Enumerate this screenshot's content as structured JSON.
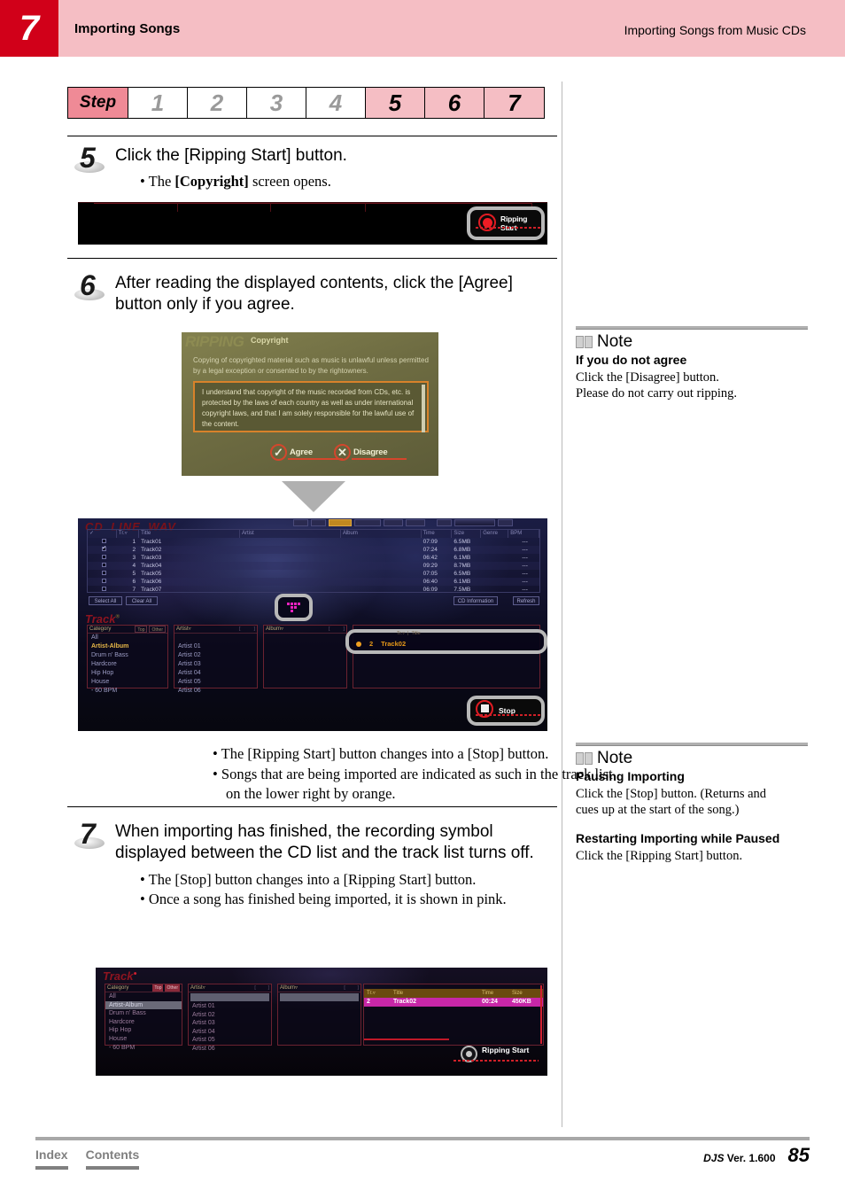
{
  "header": {
    "chapter_number": "7",
    "title": "Importing Songs",
    "subtitle": "Importing Songs from Music CDs"
  },
  "step_indicator": {
    "label": "Step",
    "steps": [
      {
        "num": "1",
        "active": false
      },
      {
        "num": "2",
        "active": false
      },
      {
        "num": "3",
        "active": false
      },
      {
        "num": "4",
        "active": false
      },
      {
        "num": "5",
        "active": true
      },
      {
        "num": "6",
        "active": true
      },
      {
        "num": "7",
        "active": true
      }
    ]
  },
  "steps": {
    "step5": {
      "number": "5",
      "text": "Click the [Ripping Start] button.",
      "bullets_pre": "The ",
      "bullets_bold": "[Copyright]",
      "bullets_post": " screen opens."
    },
    "step6": {
      "number": "6",
      "text": "After reading the displayed contents, click the [Agree] button only if you agree.",
      "bullets": [
        "The [Ripping Start] button changes into a [Stop] button.",
        "Songs that are being imported are indicated as such in the track list on the lower right by orange."
      ]
    },
    "step7": {
      "number": "7",
      "text": "When importing has finished, the recording symbol displayed between the CD list and the track list turns off.",
      "bullets": [
        "The [Stop] button changes into a [Ripping Start]  button.",
        "Once a song has finished being imported, it is shown in pink."
      ]
    }
  },
  "screenshot_ripping_bar": {
    "button_label": "Ripping Start"
  },
  "screenshot_copyright": {
    "watermark": "RIPPING",
    "dialog_title": "Copyright",
    "intro_text": "Copying of copyrighted material such as music is unlawful unless permitted by a legal exception or consented to by the rightowners.",
    "agreement_text": "I understand that copyright of the music recorded from CDs, etc. is protected by the laws of each country as well as under international copyright laws, and that I am solely responsible for the lawful use of the content.",
    "agree_label": "Agree",
    "agree_icon": "check-icon",
    "disagree_label": "Disagree",
    "disagree_icon": "cross-icon"
  },
  "screenshot_main": {
    "tabs": [
      "CD",
      "LINE",
      "WAV"
    ],
    "cd_list": {
      "columns": [
        "✓",
        "Tr.▿",
        "Title",
        "Artist",
        "Album",
        "Time",
        "Size",
        "Genre",
        "BPM"
      ],
      "rows": [
        {
          "checked": false,
          "tr": "1",
          "title": "Track01",
          "artist": "",
          "album": "",
          "time": "07:09",
          "size": "6.5MB",
          "genre": "",
          "bpm": "---"
        },
        {
          "checked": true,
          "tr": "2",
          "title": "Track02",
          "artist": "",
          "album": "",
          "time": "07:24",
          "size": "6.8MB",
          "genre": "",
          "bpm": "---"
        },
        {
          "checked": false,
          "tr": "3",
          "title": "Track03",
          "artist": "",
          "album": "",
          "time": "06:42",
          "size": "6.1MB",
          "genre": "",
          "bpm": "---"
        },
        {
          "checked": false,
          "tr": "4",
          "title": "Track04",
          "artist": "",
          "album": "",
          "time": "09:29",
          "size": "8.7MB",
          "genre": "",
          "bpm": "---"
        },
        {
          "checked": false,
          "tr": "5",
          "title": "Track05",
          "artist": "",
          "album": "",
          "time": "07:05",
          "size": "6.5MB",
          "genre": "",
          "bpm": "---"
        },
        {
          "checked": false,
          "tr": "6",
          "title": "Track06",
          "artist": "",
          "album": "",
          "time": "06:40",
          "size": "6.1MB",
          "genre": "",
          "bpm": "---"
        },
        {
          "checked": false,
          "tr": "7",
          "title": "Track07",
          "artist": "",
          "album": "",
          "time": "06:09",
          "size": "7.5MB",
          "genre": "",
          "bpm": "---"
        }
      ]
    },
    "buttons": {
      "select_all": "Select All",
      "clear_all": "Clear All",
      "cd_information": "CD Information",
      "refresh": "Refresh"
    },
    "track_logo": "Track",
    "panels": {
      "category": {
        "header": "Category",
        "header_buttons": [
          "Top",
          "Other"
        ],
        "items": [
          "All",
          "Artist-Album",
          "Drum n' Bass",
          "Hardcore",
          "Hip Hop",
          "House",
          "- 60 BPM"
        ],
        "selected": "Artist-Album"
      },
      "artist": {
        "header": "Artist▿",
        "items": [
          "Artist 01",
          "Artist 02",
          "Artist 03",
          "Artist 04",
          "Artist 05",
          "Artist 06"
        ]
      },
      "album": {
        "header": "Album▿",
        "items": []
      },
      "track": {
        "header_cols": [
          "Tr.▿",
          "Title",
          "Time",
          "Size"
        ],
        "highlighted_row": {
          "tr": "2",
          "title": "Track02"
        }
      }
    },
    "stop_button_label": "Stop"
  },
  "screenshot_final": {
    "track_logo": "Track",
    "panels": {
      "category": {
        "header": "Category",
        "header_buttons": [
          "Top",
          "Other"
        ],
        "items": [
          "All",
          "Artist-Album",
          "Drum n' Bass",
          "Hardcore",
          "Hip Hop",
          "House",
          "- 60 BPM"
        ],
        "selected": "Artist-Album"
      },
      "artist": {
        "header": "Artist▿",
        "items": [
          "Artist 01",
          "Artist 02",
          "Artist 03",
          "Artist 04",
          "Artist 05",
          "Artist 06"
        ]
      },
      "album": {
        "header": "Album▿",
        "items": []
      },
      "track": {
        "header_cols": [
          "Tr.▿",
          "Title",
          "Time",
          "Size"
        ],
        "pink_row": {
          "tr": "2",
          "title": "Track02",
          "time": "00:24",
          "size": "450KB"
        }
      }
    },
    "ripping_start_label": "Ripping Start"
  },
  "notes": [
    {
      "icon": "book-icon",
      "title": "Note",
      "subtitle": "If you do not agree",
      "lines": [
        "Click the [Disagree] button.",
        "Please do not carry out ripping."
      ]
    },
    {
      "icon": "book-icon",
      "title": "Note",
      "subtitle": "Pausing Importing",
      "lines": [
        "Click the [Stop] button. (Returns and",
        "cues up at the start of the song.)"
      ],
      "subtitle2": "Restarting Importing while Paused",
      "lines2": [
        "Click the [Ripping Start] button."
      ]
    }
  ],
  "footer": {
    "index": "Index",
    "contents": "Contents",
    "version_brand": "DJS",
    "version_text": " Ver. 1.600",
    "page": "85"
  },
  "colors": {
    "brand_red": "#d10019",
    "header_pink": "#f5bec4",
    "step_active": "#f5bec4",
    "step_label": "#ef8a96",
    "orange_accent": "#e89a18",
    "pink_row": "#c827a8"
  }
}
